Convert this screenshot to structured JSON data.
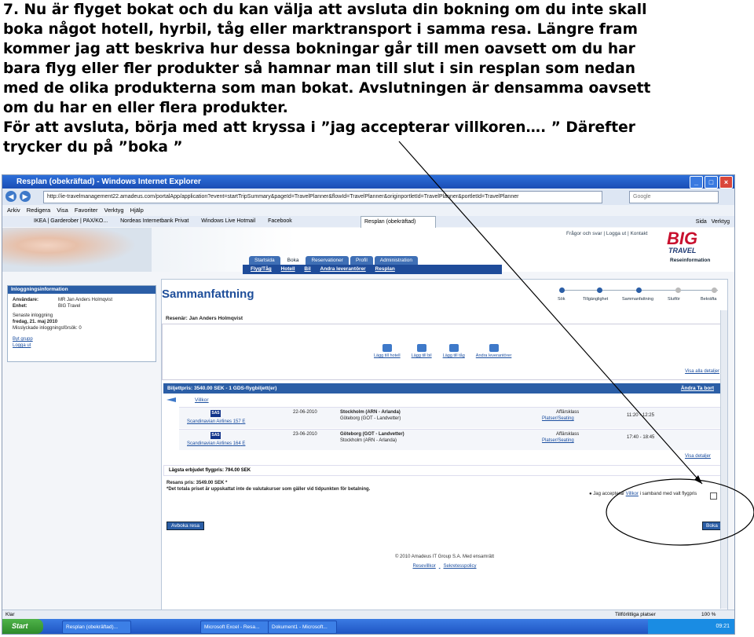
{
  "instructions": {
    "line1": "7. Nu är flyget bokat och du kan välja att avsluta din bokning om du inte skall",
    "line2": "boka något hotell, hyrbil, tåg eller marktransport i samma resa. Längre fram",
    "line3": "kommer jag att beskriva hur dessa bokningar går till men oavsett om du har",
    "line4": "bara flyg eller fler produkter så hamnar man till slut i sin resplan som nedan",
    "line5": "med de olika produkterna som man bokat. Avslutningen är densamma oavsett",
    "line6": "om du har en eller flera produkter.",
    "line7": "För att avsluta, börja med att kryssa i ”jag accepterar villkoren…. ” Därefter",
    "line8": "trycker du på ”boka ”"
  },
  "browser": {
    "title": "Resplan (obekräftad) - Windows Internet Explorer",
    "url": "http://ie-travelmanagement22.amadeus.com/portalApp/application?event=startTripSummary&pageId=TravelPlanner&flowId=TravelPlanner&originportletId=TravelPlanner&portletId=TravelPlanner",
    "search_placeholder": "Google",
    "menu": [
      "Arkiv",
      "Redigera",
      "Visa",
      "Favoriter",
      "Verktyg",
      "Hjälp"
    ],
    "favorites": [
      "IKEA | Garderober | PAX/KO...",
      "Nordeas Internetbank Privat",
      "Windows Live Hotmail",
      "Facebook"
    ],
    "active_tab": "Resplan (obekräftad)",
    "tools": [
      "Sida",
      "Verktyg"
    ]
  },
  "site": {
    "toplinks": [
      "Frågor och svar",
      "Logga ut",
      "Kontakt"
    ],
    "logo": "BIG",
    "logo_sub": "TRAVEL",
    "reseinformation": "Reseinformation",
    "nav_tabs": [
      "Startsida",
      "Boka",
      "Reservationer",
      "Profil",
      "Administration"
    ],
    "subnav": [
      "Flyg/Tåg",
      "Hotell",
      "Bil",
      "Andra leverantörer",
      "Resplan"
    ]
  },
  "login": {
    "header": "Inloggningsinformation",
    "user_label": "Användare:",
    "user_value": "MR Jan Anders Holmqvist",
    "unit_label": "Enhet:",
    "unit_value": "BIG Travel",
    "last_login_label": "Senaste inloggning",
    "last_login_value": "fredag, 21. maj 2010",
    "failed_label": "Misslyckade inloggningsförsök:",
    "failed_value": "0",
    "links": [
      "Byt grupp",
      "Logga ut"
    ]
  },
  "summary": {
    "title": "Sammanfattning",
    "steps": [
      "Sök",
      "Tillgänglighet",
      "Sammanfattning",
      "Slutför",
      "Bekräfta"
    ],
    "traveller": "Resenär: Jan Anders Holmqvist",
    "quick": [
      "Lägg till hotell",
      "Lägg till bil",
      "Lägg till tåg",
      "Andra leverantörer"
    ],
    "show_details": "Visa alla detaljer",
    "ticket_bar": "Biljettpris: 3540.00 SEK - 1 GDS-flygbiljett(er)",
    "ticket_links": "Ändra  Ta bort",
    "villkor": "Villkor",
    "flights": [
      {
        "airline": "Scandinavian Airlines",
        "flight": "157",
        "cls": "E",
        "date": "22-06-2010",
        "from": "Stockholm (ARN - Arlanda)",
        "to": "Göteborg (GOT - Landvetter)",
        "fare": "Affärsklass",
        "seating": "Platser/Seating",
        "dep": "11:20",
        "arr": "12:25"
      },
      {
        "airline": "Scandinavian Airlines",
        "flight": "164",
        "cls": "E",
        "date": "23-06-2010",
        "from": "Göteborg (GOT - Landvetter)",
        "to": "Stockholm (ARN - Arlanda)",
        "fare": "Affärsklass",
        "seating": "Platser/Seating",
        "dep": "17:40",
        "arr": "18:45"
      }
    ],
    "show_details_2": "Visa detaljer",
    "lowest_fare": "Lägsta erbjudet flygpris: 794.00 SEK",
    "total": "Resans pris: 3549.00 SEK *",
    "total_note": "*Det totala priset är uppskattat inte de valutakurser som gäller vid tidpunkten för betalning.",
    "accept_text_1": "Jag accepterar",
    "accept_link": "Villkor",
    "accept_text_2": "i samband med valt flygpris",
    "cancel_button": "Avboka resa",
    "book_button": "Boka",
    "copyright": "© 2010 Amadeus IT Group S.A. Med ensamrätt",
    "footer_links": [
      "Resevillkor",
      "Sekretesspolicy"
    ]
  },
  "statusbar": {
    "left": "Klar",
    "trusted": "Tillförlitliga platser",
    "zoom": "100 %"
  },
  "taskbar": {
    "start": "Start",
    "items": [
      "Resplan (obekräftad)...",
      "Microsoft Excel - Resa...",
      "Dokument1 - Microsoft..."
    ],
    "clock": "09:21"
  }
}
